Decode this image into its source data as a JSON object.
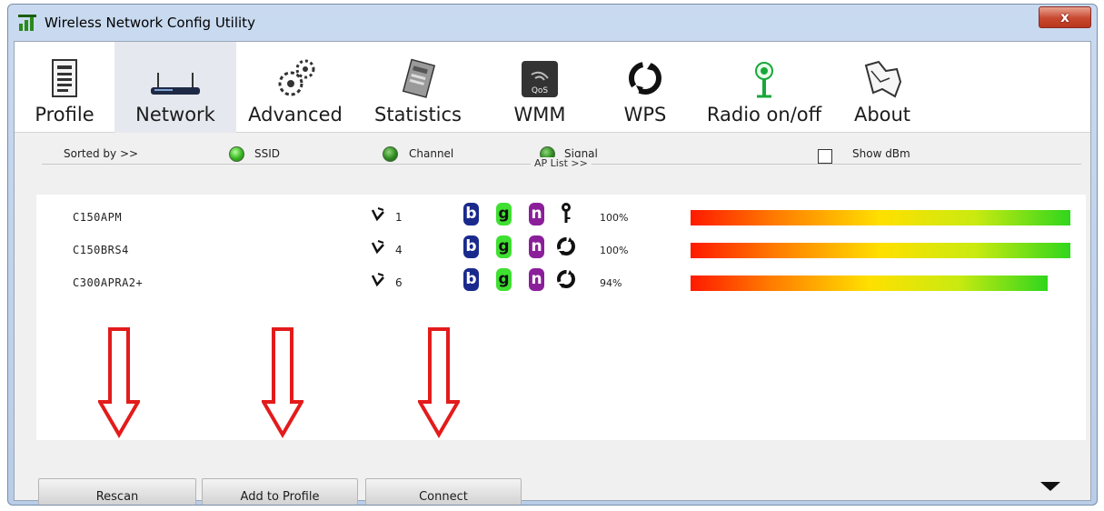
{
  "window": {
    "title": "Wireless Network Config Utility",
    "close_label": "x"
  },
  "toolbar": [
    {
      "id": "profile",
      "label": "Profile"
    },
    {
      "id": "network",
      "label": "Network"
    },
    {
      "id": "advanced",
      "label": "Advanced"
    },
    {
      "id": "statistics",
      "label": "Statistics"
    },
    {
      "id": "wmm",
      "label": "WMM"
    },
    {
      "id": "wps",
      "label": "WPS"
    },
    {
      "id": "radio",
      "label": "Radio on/off"
    },
    {
      "id": "about",
      "label": "About"
    }
  ],
  "active_tab": "Network",
  "sort": {
    "label": "Sorted by >>",
    "options": [
      "SSID",
      "Channel",
      "Signal"
    ],
    "show_dbm_label": "Show dBm",
    "show_dbm_checked": false
  },
  "ap_list": {
    "label": "AP List >>",
    "rows": [
      {
        "ssid": "C150APM",
        "channel": "1",
        "modes": [
          "b",
          "g",
          "n"
        ],
        "security": "key-icon",
        "signal_text": "100%",
        "signal": 100
      },
      {
        "ssid": "C150BRS4",
        "channel": "4",
        "modes": [
          "b",
          "g",
          "n"
        ],
        "security": "wps-icon",
        "signal_text": "100%",
        "signal": 100
      },
      {
        "ssid": "C300APRA2+",
        "channel": "6",
        "modes": [
          "b",
          "g",
          "n"
        ],
        "security": "wps-icon",
        "signal_text": "94%",
        "signal": 94
      }
    ]
  },
  "buttons": {
    "rescan": "Rescan",
    "add_to_profile": "Add to Profile",
    "connect": "Connect"
  },
  "colors": {
    "annotation_arrow": "#e31b1b",
    "titlebar": "#c9daf0",
    "mode_b": "#1a2a8c",
    "mode_g": "#3fe031",
    "mode_n": "#8b1f9a"
  }
}
